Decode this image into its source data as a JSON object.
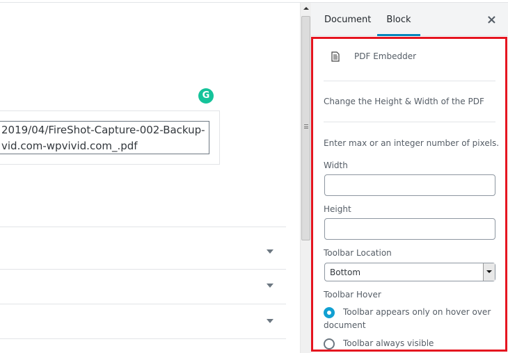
{
  "editor": {
    "file_url_line1": "2019/04/FireShot-Capture-002-Backup-",
    "file_url_line2": "vid.com-wpvivid.com_.pdf",
    "grammarly_icon": "G",
    "panels": [
      "collapsed",
      "collapsed",
      "collapsed"
    ]
  },
  "sidebar": {
    "tabs": [
      {
        "label": "Document"
      },
      {
        "label": "Block",
        "active": true
      }
    ],
    "close_icon": "×",
    "block": {
      "icon": "document-icon",
      "name": "PDF Embedder"
    },
    "section_title": "Change the Height & Width of the PDF",
    "help_text": "Enter max or an integer number of pixels.",
    "width_label": "Width",
    "width_value": "",
    "height_label": "Height",
    "height_value": "",
    "toolbar_location_label": "Toolbar Location",
    "toolbar_location_value": "Bottom",
    "toolbar_hover_label": "Toolbar Hover",
    "hover_options": [
      {
        "label_line1": "Toolbar appears only on hover over",
        "label_line2": "document",
        "selected": true
      },
      {
        "label": "Toolbar always visible",
        "selected": false
      }
    ]
  },
  "colors": {
    "accent": "#0085ba",
    "highlight_box": "#e5141f",
    "radio": "#11a0d2",
    "grammarly": "#15c39a"
  }
}
